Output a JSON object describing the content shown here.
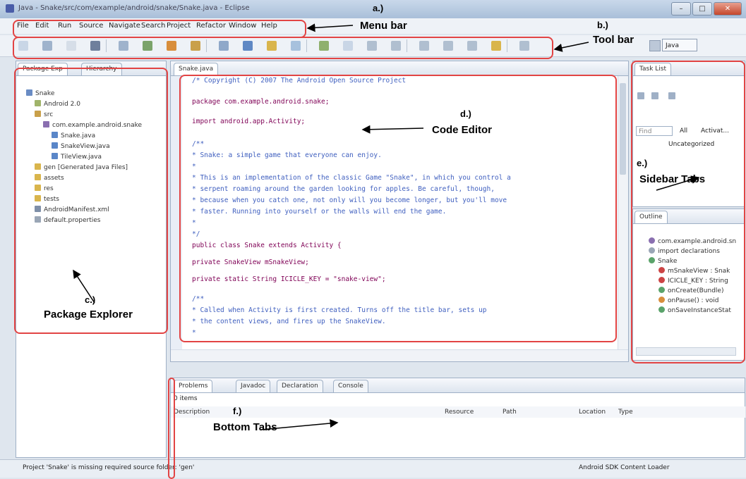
{
  "window": {
    "title": "Java - Snake/src/com/example/android/snake/Snake.java - Eclipse",
    "perspective": "Java"
  },
  "menu": [
    "File",
    "Edit",
    "Run",
    "Source",
    "Navigate",
    "Search",
    "Project",
    "Refactor",
    "Window",
    "Help"
  ],
  "annotations": {
    "a": "a.)",
    "menu_bar": "Menu bar",
    "b": "b.)",
    "tool_bar": "Tool bar",
    "c": "c.)",
    "package_explorer": "Package Explorer",
    "d": "d.)",
    "code_editor": "Code Editor",
    "e": "e.)",
    "sidebar_tabs": "Sidebar Tabs",
    "f": "f.)",
    "bottom_tabs": "Bottom Tabs"
  },
  "left_panel": {
    "tabs": [
      "Package Exp",
      "Hierarchy"
    ],
    "tree": [
      {
        "label": "Snake",
        "icon": "project-icon",
        "indent": 0
      },
      {
        "label": "Android 2.0",
        "icon": "library-icon",
        "indent": 1
      },
      {
        "label": "src",
        "icon": "source-folder-icon",
        "indent": 1
      },
      {
        "label": "com.example.android.snake",
        "icon": "package-icon",
        "indent": 2
      },
      {
        "label": "Snake.java",
        "icon": "java-file-icon",
        "indent": 3
      },
      {
        "label": "SnakeView.java",
        "icon": "java-file-icon",
        "indent": 3
      },
      {
        "label": "TileView.java",
        "icon": "java-file-icon",
        "indent": 3
      },
      {
        "label": "gen [Generated Java Files]",
        "icon": "folder-icon",
        "indent": 1
      },
      {
        "label": "assets",
        "icon": "folder-icon",
        "indent": 1
      },
      {
        "label": "res",
        "icon": "folder-icon",
        "indent": 1
      },
      {
        "label": "tests",
        "icon": "folder-icon",
        "indent": 1
      },
      {
        "label": "AndroidManifest.xml",
        "icon": "xml-file-icon",
        "indent": 1
      },
      {
        "label": "default.properties",
        "icon": "file-icon",
        "indent": 1
      }
    ]
  },
  "editor": {
    "tab": "Snake.java",
    "lines": [
      {
        "text": "/* Copyright (C) 2007 The Android Open Source Project",
        "cls": "comment"
      },
      {
        "text": "package com.example.android.snake;",
        "cls": "kw"
      },
      {
        "text": "import android.app.Activity;",
        "cls": "kw"
      },
      {
        "text": "/**",
        "cls": "comment"
      },
      {
        "text": " * Snake: a simple game that everyone can enjoy.",
        "cls": "comment"
      },
      {
        "text": " *",
        "cls": "comment"
      },
      {
        "text": " * This is an implementation of the classic Game \"Snake\", in which you control a",
        "cls": "comment"
      },
      {
        "text": " * serpent roaming around the garden looking for apples. Be careful, though,",
        "cls": "comment"
      },
      {
        "text": " * because when you catch one, not only will you become longer, but you'll move",
        "cls": "comment"
      },
      {
        "text": " * faster. Running into yourself or the walls will end the game.",
        "cls": "comment"
      },
      {
        "text": " *",
        "cls": "comment"
      },
      {
        "text": " */",
        "cls": "comment"
      },
      {
        "text": "public class Snake extends Activity {",
        "cls": "kw"
      },
      {
        "text": "    private SnakeView mSnakeView;",
        "cls": "kw"
      },
      {
        "text": "    private static String ICICLE_KEY = \"snake-view\";",
        "cls": "kw"
      },
      {
        "text": "    /**",
        "cls": "comment"
      },
      {
        "text": "     * Called when Activity is first created. Turns off the title bar, sets up",
        "cls": "comment"
      },
      {
        "text": "     * the content views, and fires up the SnakeView.",
        "cls": "comment"
      },
      {
        "text": "     *",
        "cls": "comment"
      }
    ]
  },
  "task_list": {
    "tab": "Task List",
    "find_placeholder": "Find",
    "filter_all": "All",
    "filter_activate": "Activat...",
    "category": "Uncategorized"
  },
  "outline": {
    "tab": "Outline",
    "items": [
      {
        "label": "com.example.android.sn",
        "indent": 0
      },
      {
        "label": "import declarations",
        "indent": 0
      },
      {
        "label": "Snake",
        "indent": 0
      },
      {
        "label": "mSnakeView : Snak",
        "indent": 1
      },
      {
        "label": "ICICLE_KEY : String",
        "indent": 1
      },
      {
        "label": "onCreate(Bundle)",
        "indent": 1
      },
      {
        "label": "onPause() : void",
        "indent": 1
      },
      {
        "label": "onSaveInstanceStat",
        "indent": 1
      }
    ]
  },
  "bottom": {
    "tabs": [
      "Problems",
      "Javadoc",
      "Declaration",
      "Console"
    ],
    "count": "0 items",
    "columns": [
      "Description",
      "Resource",
      "Path",
      "Location",
      "Type"
    ]
  },
  "status": {
    "message": "Project 'Snake' is missing required source folder: 'gen'",
    "right": "Android SDK Content Loader"
  },
  "colors": {
    "annotation_border": "#e24444",
    "comment": "#3f5fbf",
    "keyword": "#7f0055"
  }
}
